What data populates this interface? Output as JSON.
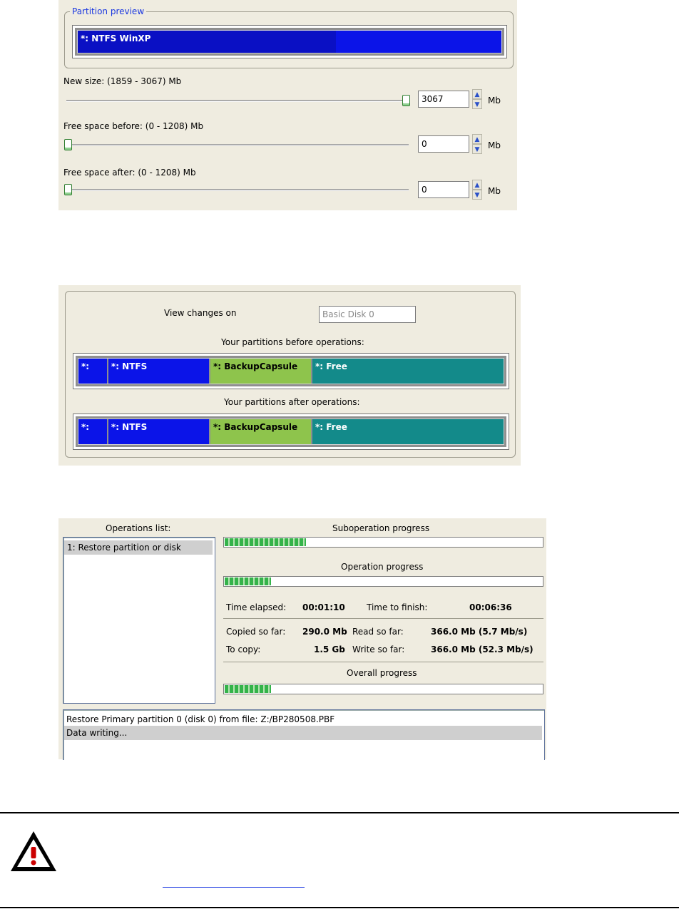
{
  "partition_preview": {
    "legend": "Partition preview",
    "partition_label": "*: NTFS WinXP",
    "used_fraction": 0.61,
    "new_size_label": "New size: (1859 - 3067) Mb",
    "new_size_value": "3067",
    "new_size_slider_fraction": 1.0,
    "free_before_label": "Free space before: (0 - 1208) Mb",
    "free_before_value": "0",
    "free_after_label": "Free space after: (0 - 1208) Mb",
    "free_after_value": "0",
    "unit": "Mb",
    "spin_up_icon": "chevron-up-icon",
    "spin_down_icon": "chevron-down-icon"
  },
  "changes": {
    "view_label": "View changes on",
    "disk_value": "Basic Disk 0",
    "before_title": "Your partitions before operations:",
    "after_title": "Your partitions after operations:",
    "partitions": [
      {
        "label": "*:",
        "color": "#0b14e8"
      },
      {
        "label": "*: NTFS",
        "color": "#0b14e8"
      },
      {
        "label": "*: BackupCapsule",
        "color": "#8ec44c"
      },
      {
        "label": "*: Free",
        "color": "#138a8a"
      }
    ]
  },
  "operations": {
    "list_title": "Operations list:",
    "items": [
      "1: Restore partition or disk"
    ],
    "sub_title": "Suboperation progress",
    "sub_fraction": 0.26,
    "op_title": "Operation progress",
    "op_fraction": 0.15,
    "time_elapsed_label": "Time elapsed:",
    "time_elapsed_value": "00:01:10",
    "time_finish_label": "Time to finish:",
    "time_finish_value": "00:06:36",
    "copied_label": "Copied so far:",
    "copied_value": "290.0 Mb",
    "read_label": "Read so far:",
    "read_value": "366.0 Mb (5.7 Mb/s)",
    "tocopy_label": "To copy:",
    "tocopy_value": "1.5 Gb",
    "write_label": "Write so far:",
    "write_value": "366.0 Mb (52.3 Mb/s)",
    "overall_title": "Overall progress",
    "overall_fraction": 0.15,
    "log": [
      "Restore Primary partition 0 (disk 0) from file: Z:/BP280508.PBF",
      "Data writing..."
    ]
  },
  "warning": {
    "icon": "warning-icon",
    "accent": "#cc0000"
  }
}
